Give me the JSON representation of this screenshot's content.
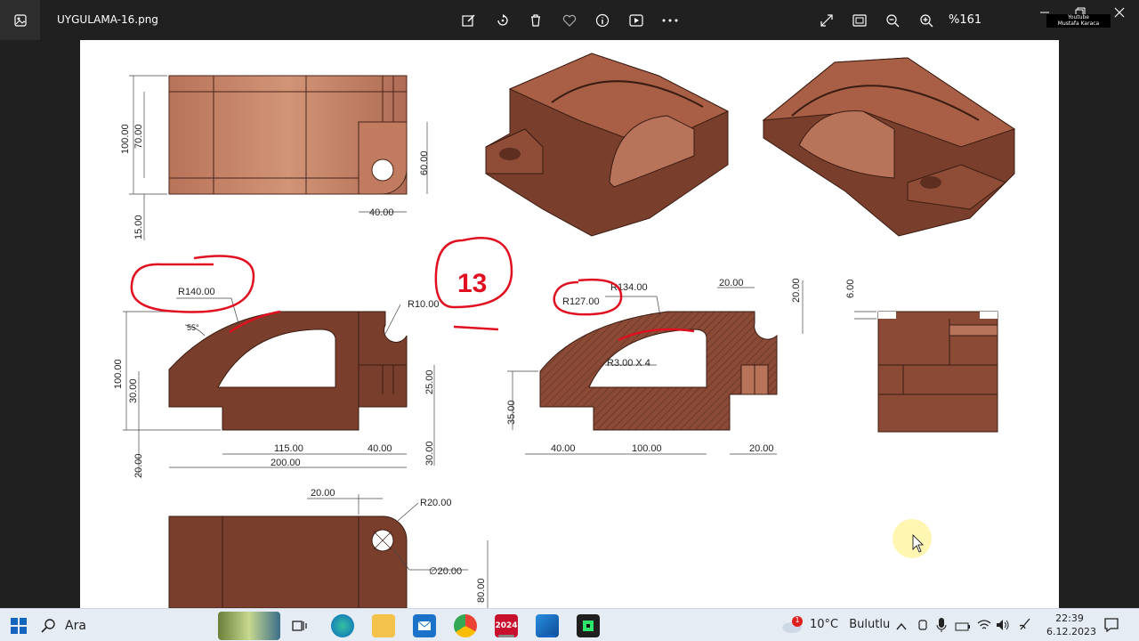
{
  "window": {
    "file_name": "UYGULAMA-16.png",
    "zoom": "%161",
    "watermark_line1": "Youtube",
    "watermark_line2": "Mustafa Karaca"
  },
  "toolbar": {
    "icons": [
      "edit-image-icon",
      "rotate-icon",
      "delete-icon",
      "favorite-icon",
      "info-icon",
      "slideshow-icon",
      "more-icon",
      "fullscreen-icon",
      "fit-icon",
      "zoom-out-icon",
      "zoom-in-icon"
    ]
  },
  "drawing": {
    "top_view": {
      "dim_100": "100.00",
      "dim_70": "70.00",
      "dim_60": "60.00",
      "dim_40": "40.00",
      "dim_15": "15.00"
    },
    "front_view": {
      "r140": "R140.00",
      "r10": "R10.00",
      "angle": "55°",
      "dim_100": "100.00",
      "dim_30": "30.00",
      "dim_25": "25.00",
      "dim_20": "20.00",
      "dim_115": "115.00",
      "dim_40": "40.00",
      "dim_200": "200.00",
      "dim_30b": "30.00"
    },
    "annotation_number": "13",
    "section_view": {
      "r134": "R134.00",
      "r127": "R127.00",
      "dim_20a": "20.00",
      "dim_20b": "20.00",
      "fillet": "R3.00 X 4",
      "dim_35": "35.00",
      "dim_40": "40.00",
      "dim_100": "100.00",
      "dim_20c": "20.00"
    },
    "side_view": {
      "dim_6": "6.00"
    },
    "bottom_view": {
      "dim_20": "20.00",
      "r20": "R20.00",
      "dia20": "∅20.00",
      "dim_80": "80.00"
    },
    "colors": {
      "part": "#8a4a36",
      "part_light": "#b8735b",
      "part_dark": "#5e2e20",
      "markup": "#e01020"
    }
  },
  "taskbar": {
    "search_placeholder": "Ara",
    "weather_temp": "10°C",
    "weather_text": "Bulutlu",
    "weather_badge": "1",
    "time": "22:39",
    "date": "6.12.2023",
    "solidworks_label": "2024"
  }
}
